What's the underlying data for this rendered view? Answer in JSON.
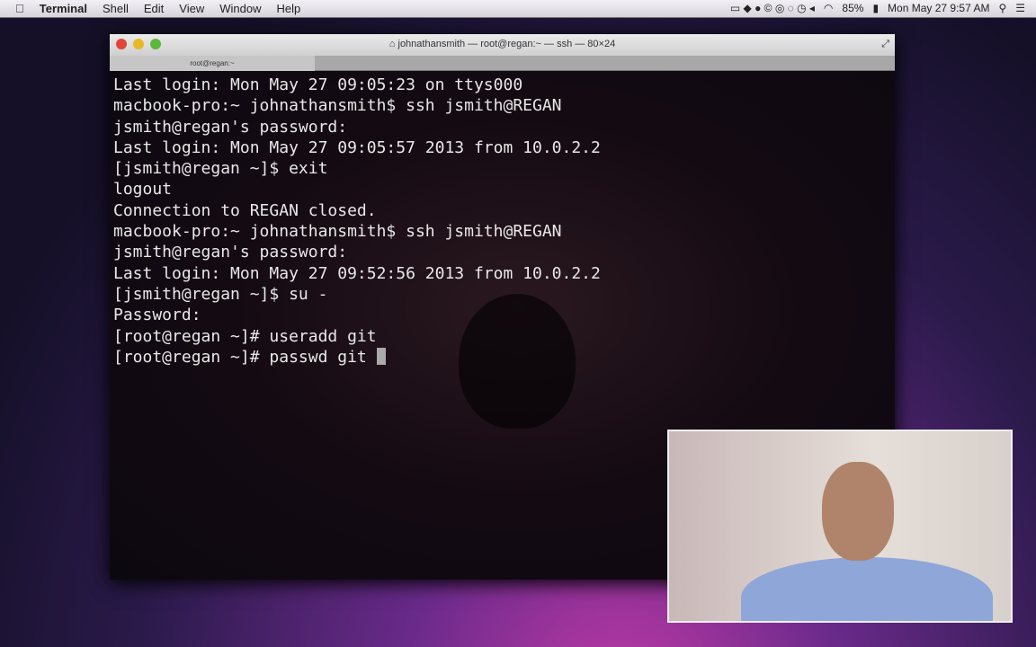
{
  "menubar": {
    "app": "Terminal",
    "items": [
      "Shell",
      "Edit",
      "View",
      "Window",
      "Help"
    ],
    "battery": "85%",
    "clock": "Mon May 27  9:57 AM"
  },
  "window": {
    "title": "johnathansmith — root@regan:~ — ssh — 80×24",
    "tab": "root@regan:~"
  },
  "terminal": {
    "lines": [
      "Last login: Mon May 27 09:05:23 on ttys000",
      "macbook-pro:~ johnathansmith$ ssh jsmith@REGAN",
      "jsmith@regan's password:",
      "Last login: Mon May 27 09:05:57 2013 from 10.0.2.2",
      "[jsmith@regan ~]$ exit",
      "logout",
      "Connection to REGAN closed.",
      "macbook-pro:~ johnathansmith$ ssh jsmith@REGAN",
      "jsmith@regan's password:",
      "Last login: Mon May 27 09:52:56 2013 from 10.0.2.2",
      "[jsmith@regan ~]$ su -",
      "Password:",
      "[root@regan ~]# useradd git",
      "[root@regan ~]# passwd git "
    ]
  }
}
